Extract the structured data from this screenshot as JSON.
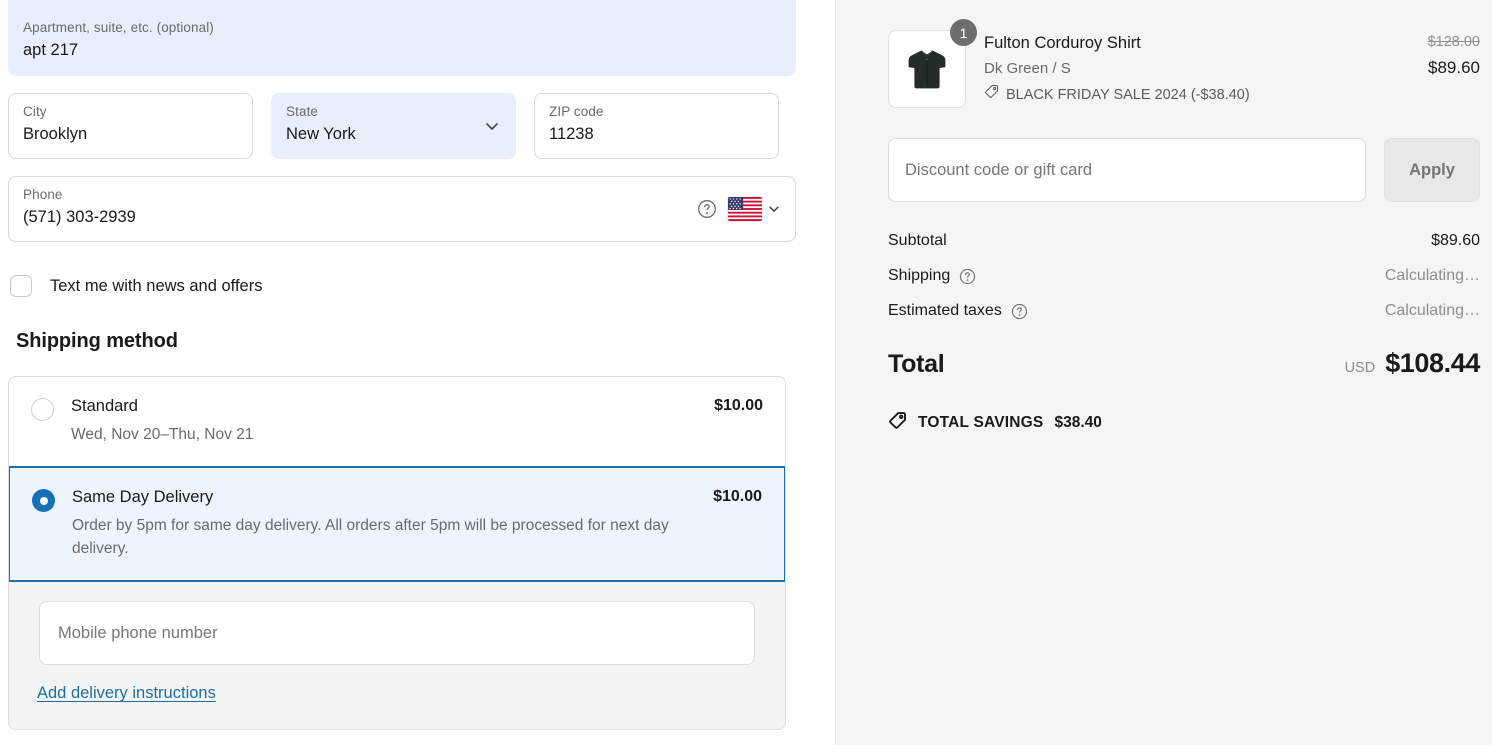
{
  "shipping_form": {
    "apartment": {
      "label": "Apartment, suite, etc. (optional)",
      "value": "apt 217"
    },
    "city": {
      "label": "City",
      "value": "Brooklyn"
    },
    "state": {
      "label": "State",
      "value": "New York",
      "chevron_icon": "chevron-down-icon"
    },
    "zip": {
      "label": "ZIP code",
      "value": "11238"
    },
    "phone": {
      "label": "Phone",
      "value": "(571) 303-2939",
      "help_icon": "question-circle-icon",
      "flag_icon": "us-flag-icon",
      "chevron_icon": "chevron-down-icon"
    },
    "sms_optin": {
      "label": "Text me with news and offers",
      "checked": false
    }
  },
  "shipping_method": {
    "title": "Shipping method",
    "options": [
      {
        "name": "Standard",
        "subtitle": "Wed, Nov 20–Thu, Nov 21",
        "price": "$10.00",
        "selected": false
      },
      {
        "name": "Same Day Delivery",
        "subtitle": "Order by 5pm for same day delivery. All orders after 5pm will be processed for next day delivery.",
        "price": "$10.00",
        "selected": true
      }
    ],
    "mobile_placeholder": "Mobile phone number",
    "instructions_link": "Add delivery instructions"
  },
  "order_summary": {
    "product": {
      "title": "Fulton Corduroy Shirt",
      "variant": "Dk Green / S",
      "discount": "BLACK FRIDAY SALE 2024 (-$38.40)",
      "discount_icon": "tag-icon",
      "quantity": "1",
      "price_original": "$128.00",
      "price_final": "$89.60",
      "image_name": "product-thumbnail-shirt"
    },
    "discount_field": {
      "placeholder": "Discount code or gift card",
      "value": ""
    },
    "apply_button": "Apply",
    "lines": [
      {
        "label": "Subtotal",
        "value": "$89.60",
        "muted": false,
        "help": false
      },
      {
        "label": "Shipping",
        "value": "Calculating…",
        "muted": true,
        "help": true
      },
      {
        "label": "Estimated taxes",
        "value": "Calculating…",
        "muted": true,
        "help": true
      }
    ],
    "total": {
      "label": "Total",
      "currency": "USD",
      "amount": "$108.44"
    },
    "savings": {
      "label": "TOTAL SAVINGS",
      "amount": "$38.40",
      "icon": "tag-icon"
    }
  },
  "colors": {
    "accent_blue": "#1570b8",
    "autofill_blue": "#e8eefc",
    "selected_bg": "#eef4fd",
    "link_blue": "#1d6ea0",
    "panel_bg": "#f5f5f5",
    "product_green": "#232c25"
  }
}
